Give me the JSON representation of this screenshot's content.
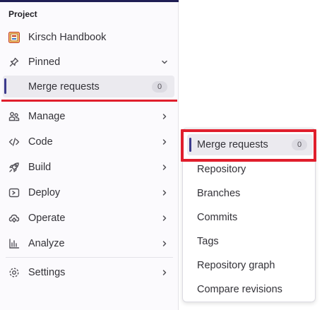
{
  "sidebar": {
    "section_title": "Project",
    "project": {
      "name": "Kirsch Handbook",
      "icon": "project-avatar-icon"
    },
    "pinned": {
      "label": "Pinned",
      "icon": "pin-icon"
    },
    "pinned_items": [
      {
        "label": "Merge requests",
        "badge": "0"
      }
    ],
    "items": [
      {
        "label": "Manage",
        "icon": "users-icon"
      },
      {
        "label": "Code",
        "icon": "code-icon"
      },
      {
        "label": "Build",
        "icon": "rocket-icon"
      },
      {
        "label": "Deploy",
        "icon": "deploy-icon"
      },
      {
        "label": "Operate",
        "icon": "cloud-gear-icon"
      },
      {
        "label": "Analyze",
        "icon": "chart-icon"
      }
    ],
    "settings": {
      "label": "Settings",
      "icon": "gear-icon"
    }
  },
  "flyout": {
    "items": [
      {
        "label": "Merge requests",
        "badge": "0",
        "active": true
      },
      {
        "label": "Repository"
      },
      {
        "label": "Branches"
      },
      {
        "label": "Commits"
      },
      {
        "label": "Tags"
      },
      {
        "label": "Repository graph"
      },
      {
        "label": "Compare revisions"
      }
    ]
  },
  "colors": {
    "active_indicator": "#3b3a8c",
    "highlight": "#e01e2c",
    "active_bg": "#ebeaef"
  }
}
